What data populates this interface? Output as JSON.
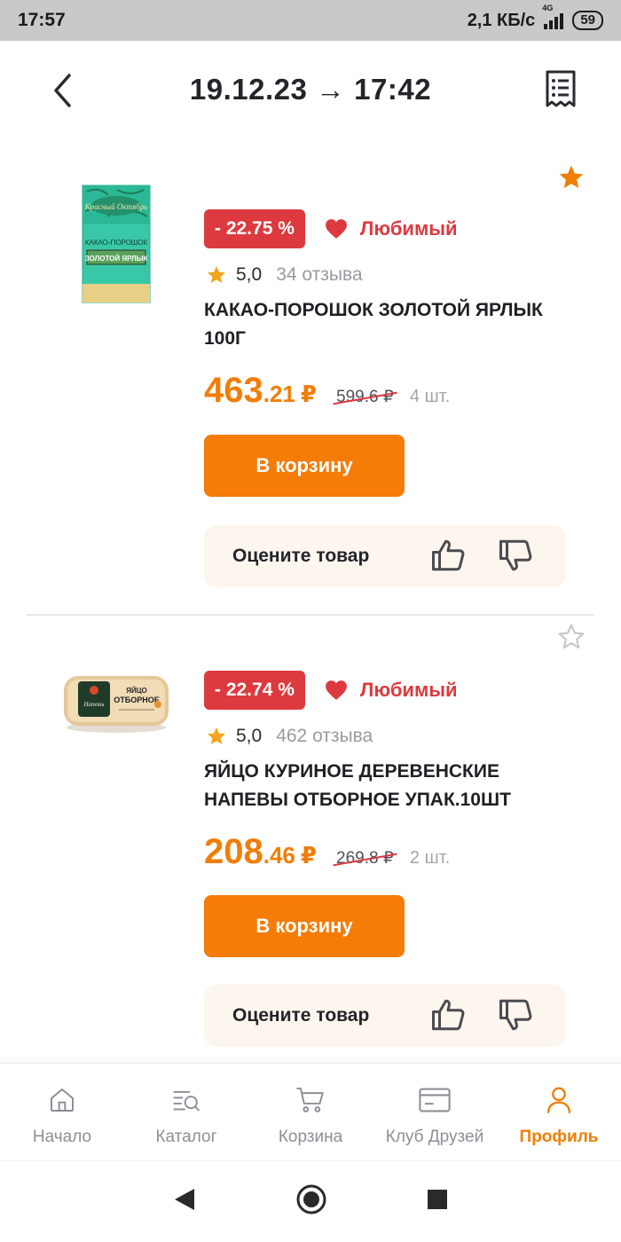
{
  "status_bar": {
    "time": "17:57",
    "speed": "2,1 КБ/с",
    "network": "4G",
    "battery": "59"
  },
  "header": {
    "title": "19.12.23 → 17:42",
    "back_icon": "chevron-left-icon",
    "receipt_icon": "receipt-icon"
  },
  "products": [
    {
      "favorite_star": "filled",
      "discount": "- 22.75 %",
      "fav_label": "Любимый",
      "rating": "5,0",
      "reviews": "34 отзыва",
      "name": "КАКАО-ПОРОШОК ЗОЛОТОЙ ЯРЛЫК 100Г",
      "price_main": "463",
      "price_cents": ".21",
      "currency": "₽",
      "old_price": "599.6 ₽",
      "quantity": "4 шт.",
      "cart_label": "В корзину",
      "rate_label": "Оцените товар",
      "image_text_brand": "Красный Октябрь",
      "image_text_top": "КАКАО-ПОРОШОК",
      "image_text_main": "ЗОЛОТОЙ ЯРЛЫК"
    },
    {
      "favorite_star": "outline",
      "discount": "- 22.74 %",
      "fav_label": "Любимый",
      "rating": "5,0",
      "reviews": "462 отзыва",
      "name": "ЯЙЦО КУРИНОЕ ДЕРЕВЕНСКИЕ НАПЕВЫ ОТБОРНОЕ УПАК.10ШТ",
      "price_main": "208",
      "price_cents": ".46",
      "currency": "₽",
      "old_price": "269.8 ₽",
      "quantity": "2 шт.",
      "cart_label": "В корзину",
      "rate_label": "Оцените товар",
      "image_text_top": "ЯЙЦО",
      "image_text_main": "ОТБОРНОЕ"
    }
  ],
  "bottom_nav": [
    {
      "label": "Начало",
      "icon": "home-icon"
    },
    {
      "label": "Каталог",
      "icon": "catalog-search-icon"
    },
    {
      "label": "Корзина",
      "icon": "cart-icon"
    },
    {
      "label": "Клуб Друзей",
      "icon": "card-icon"
    },
    {
      "label": "Профиль",
      "icon": "profile-icon",
      "active": true
    }
  ],
  "colors": {
    "accent": "#f47c07",
    "price": "#f07e06",
    "discount": "#dc3a3e",
    "rate_bg": "#fdf6ee"
  }
}
